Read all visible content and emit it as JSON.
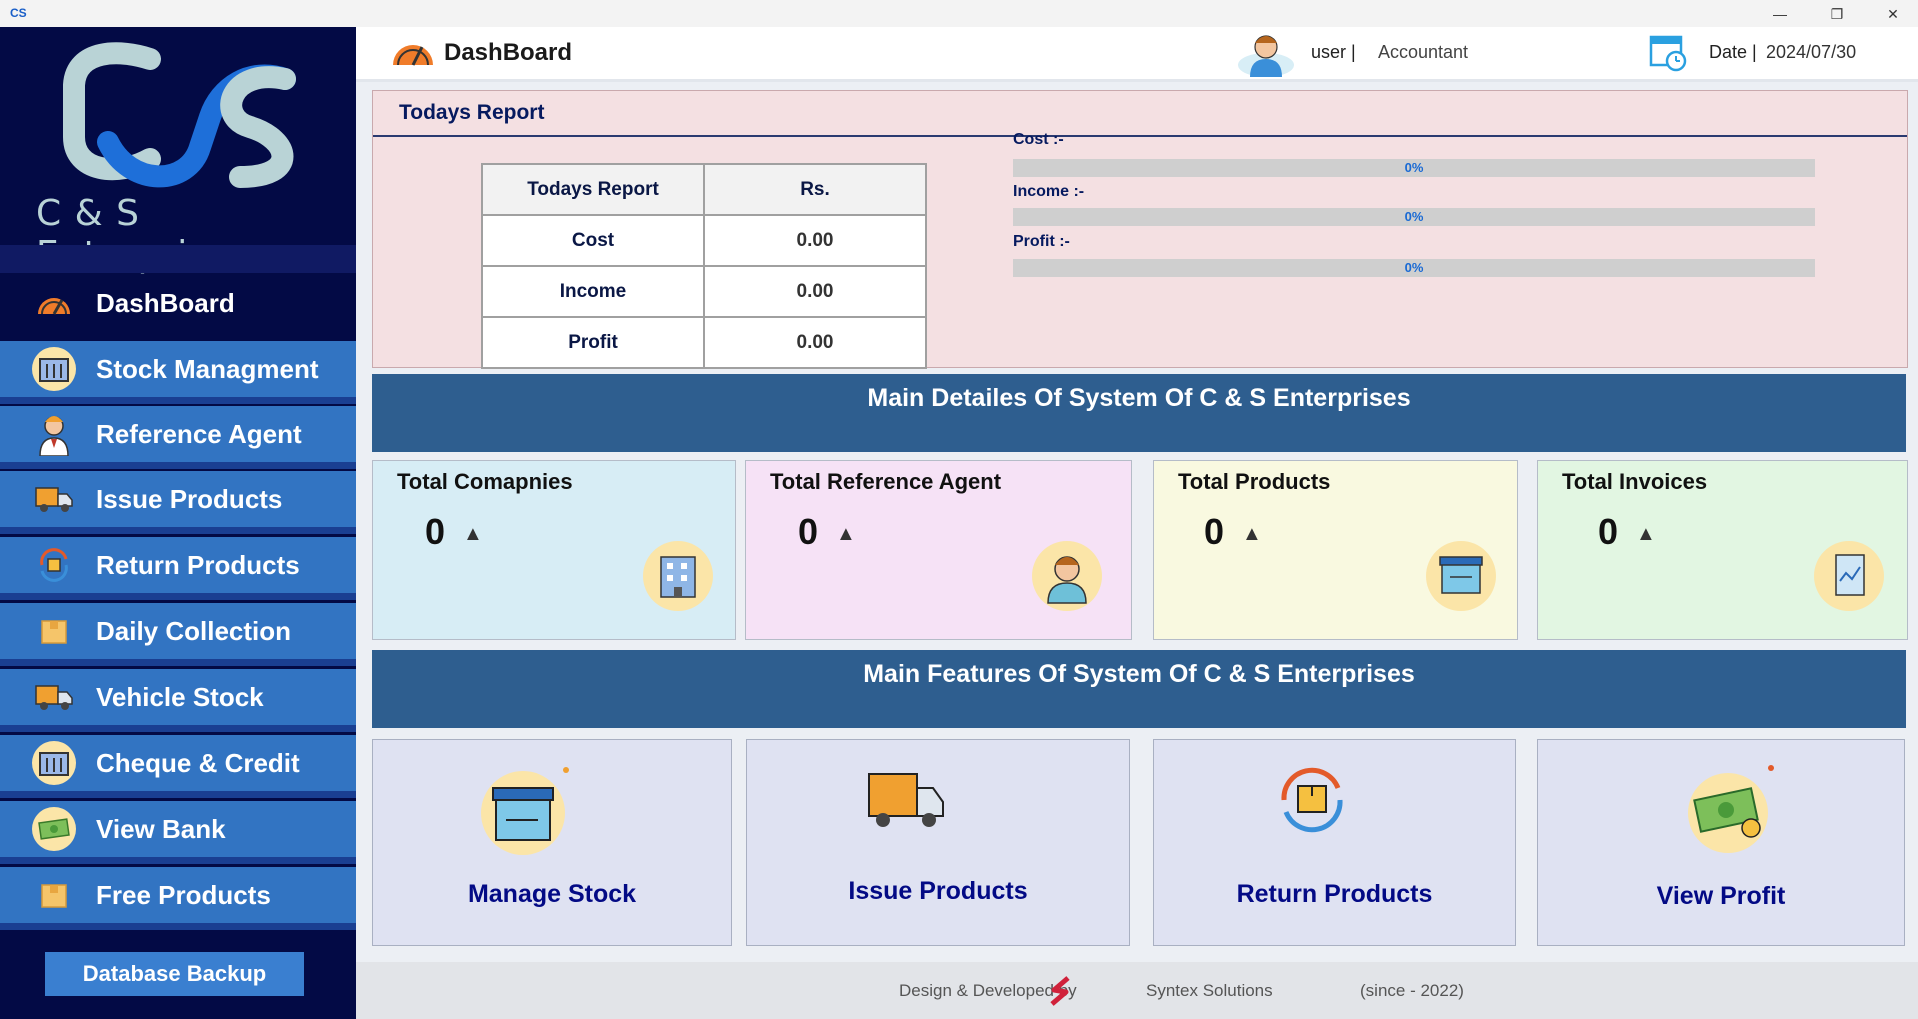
{
  "window": {
    "logo_text": "CS",
    "minimize": "—",
    "restore": "❐",
    "close": "✕"
  },
  "sidebar": {
    "company_name": "C & S Enterprises",
    "items": [
      {
        "label": "DashBoard",
        "icon": "dashboard-gauge-icon"
      },
      {
        "label": "Stock Managment",
        "icon": "stock-icon"
      },
      {
        "label": "Reference Agent",
        "icon": "agent-icon"
      },
      {
        "label": "Issue Products",
        "icon": "truck-icon"
      },
      {
        "label": "Return Products",
        "icon": "return-icon"
      },
      {
        "label": "Daily Collection",
        "icon": "box-icon"
      },
      {
        "label": "Vehicle Stock",
        "icon": "truck-icon"
      },
      {
        "label": "Cheque & Credit",
        "icon": "stock-icon"
      },
      {
        "label": "View Bank",
        "icon": "money-icon"
      },
      {
        "label": "Free Products",
        "icon": "box-icon"
      }
    ],
    "backup_label": "Database Backup"
  },
  "header": {
    "title": "DashBoard",
    "user_label": "user |",
    "role": "Accountant",
    "date_label": "Date |",
    "date_value": "2024/07/30"
  },
  "report": {
    "title": "Todays Report",
    "table_headers": [
      "Todays Report",
      "Rs."
    ],
    "rows": [
      {
        "label": "Cost",
        "value": "0.00"
      },
      {
        "label": "Income",
        "value": "0.00"
      },
      {
        "label": "Profit",
        "value": "0.00"
      }
    ],
    "bars": [
      {
        "label": "Cost :-",
        "percent_text": "0%",
        "percent": 0
      },
      {
        "label": "Income :-",
        "percent_text": "0%",
        "percent": 0
      },
      {
        "label": "Profit :-",
        "percent_text": "0%",
        "percent": 0
      }
    ]
  },
  "details": {
    "title": "Main Detailes Of System Of C & S Enterprises",
    "cards": [
      {
        "title": "Total Comapnies",
        "value": "0",
        "arrow": "▲",
        "color": "#d7edf5",
        "icon": "building-icon"
      },
      {
        "title": "Total Reference Agent",
        "value": "0",
        "arrow": "▲",
        "color": "#f6e2f6",
        "icon": "person-icon"
      },
      {
        "title": "Total Products",
        "value": "0",
        "arrow": "▲",
        "color": "#f9f9e0",
        "icon": "product-box-icon"
      },
      {
        "title": "Total Invoices",
        "value": "0",
        "arrow": "▲",
        "color": "#e2f6e2",
        "icon": "invoice-icon"
      }
    ]
  },
  "features": {
    "title": "Main Features Of System Of C & S Enterprises",
    "cards": [
      {
        "label": "Manage Stock",
        "icon": "stock-box-icon"
      },
      {
        "label": "Issue Products",
        "icon": "delivery-truck-icon"
      },
      {
        "label": "Return Products",
        "icon": "return-package-icon"
      },
      {
        "label": "View Profit",
        "icon": "money-bill-icon"
      }
    ]
  },
  "footer": {
    "designed_by": "Design & Developed by",
    "company": "Syntex Solutions",
    "since": "(since - 2022)"
  }
}
